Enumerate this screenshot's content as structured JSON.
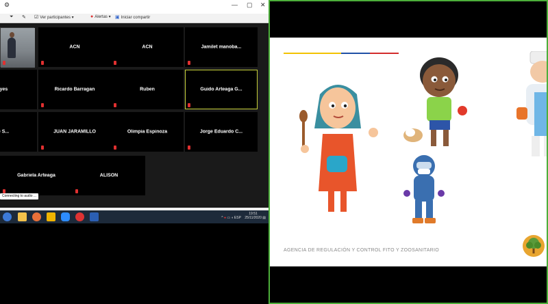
{
  "toolbar": {
    "participants_label": "Ver participantes",
    "alerts_label": "Alertas",
    "share_label": "Iniciar compartir"
  },
  "participants": [
    {
      "name": "",
      "has_video": true,
      "active": false
    },
    {
      "name": "ACN",
      "has_video": false,
      "active": false
    },
    {
      "name": "ACN",
      "has_video": false,
      "active": false
    },
    {
      "name": "Jamilet  manoba...",
      "has_video": false,
      "active": false
    },
    {
      "name": "Reyes",
      "has_video": false,
      "active": false
    },
    {
      "name": "Ricardo Barragan",
      "has_video": false,
      "active": false
    },
    {
      "name": "Ruben",
      "has_video": false,
      "active": false
    },
    {
      "name": "Guido Arteaga G...",
      "has_video": false,
      "active": true
    },
    {
      "name": "ene S...",
      "has_video": false,
      "active": false
    },
    {
      "name": "JUAN JARAMILLO",
      "has_video": false,
      "active": false
    },
    {
      "name": "Olimpia Espinoza",
      "has_video": false,
      "active": false
    },
    {
      "name": "Jorge Eduardo C...",
      "has_video": false,
      "active": false
    },
    {
      "name": "Gabriela Arteaga",
      "has_video": false,
      "active": false
    },
    {
      "name": "ALISON",
      "has_video": false,
      "active": false
    }
  ],
  "status_text": "Connecting to audio ...",
  "tray": {
    "language": "ESP",
    "time": "19:51",
    "date": "25/11/2020"
  },
  "slide": {
    "footer_text": "AGENCIA DE REGULACIÓN Y CONTROL FITO Y ZOOSANITARIO"
  },
  "colors": {
    "active_border": "#c8d23a",
    "share_border": "#4caf3a",
    "stripe_yellow": "#f2c200",
    "stripe_blue": "#1f4fa5",
    "stripe_red": "#d22b2b"
  }
}
